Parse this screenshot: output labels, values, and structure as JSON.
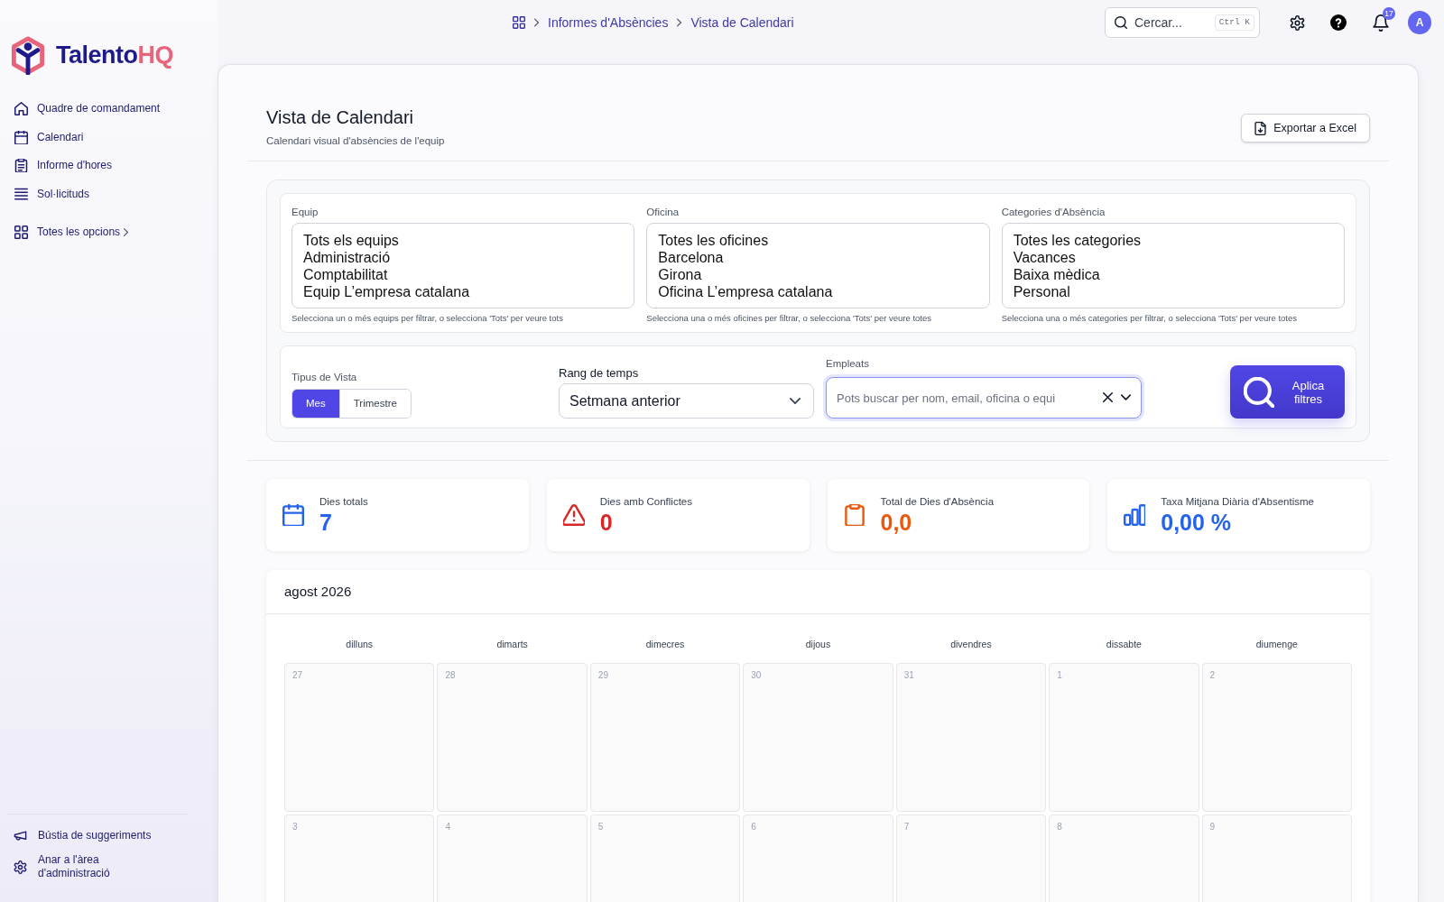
{
  "logo": {
    "name": "Talento",
    "accent": "HQ"
  },
  "sidebar": {
    "items": [
      {
        "kind": "home",
        "label": "Quadre de comandament"
      },
      {
        "kind": "calendar",
        "label": "Calendari"
      },
      {
        "kind": "timesheet",
        "label": "Informe d'hores"
      },
      {
        "kind": "requests",
        "label": "Sol·licituds"
      }
    ],
    "more": {
      "label": "Totes les opcions"
    },
    "footer": [
      {
        "kind": "feedback",
        "label": "Bústia de suggeriments"
      },
      {
        "kind": "admin",
        "label": "Anar a l'àrea d'administració"
      }
    ]
  },
  "breadcrumb": [
    {
      "label": "Informes d'Absències"
    },
    {
      "label": "Vista de Calendari"
    }
  ],
  "top_bar": {
    "search": {
      "placeholder": "Cercar...",
      "shortcut": "Ctrl K"
    },
    "notification_count": "17",
    "avatar": "A"
  },
  "header": {
    "title": "Vista de Calendari",
    "subtitle": "Calendari visual d'absències de l'equip",
    "export_button": "Exportar a Excel"
  },
  "filters": {
    "lists": [
      {
        "label": "Equip",
        "options": [
          "Tots els equips",
          "Administració",
          "Comptabilitat",
          "Equip L’empresa catalana"
        ],
        "help": "Selecciona un o més equips per filtrar, o selecciona 'Tots' per veure tots"
      },
      {
        "label": "Oficina",
        "options": [
          "Totes les oficines",
          "Barcelona",
          "Girona",
          "Oficina L’empresa catalana"
        ],
        "help": "Selecciona una o més oficines per filtrar, o selecciona 'Tots' per veure totes"
      },
      {
        "label": "Categories d'Absència",
        "options": [
          "Totes les categories",
          "Vacances",
          "Baixa mèdica",
          "Personal"
        ],
        "help": "Selecciona una o més categories per filtrar, o selecciona 'Tots' per veure totes"
      }
    ],
    "view_type": {
      "label": "Tipus de Vista",
      "options": [
        {
          "label": "Mes",
          "selected": true
        },
        {
          "label": "Trimestre",
          "selected": false
        }
      ]
    },
    "time_range": {
      "label": "Rang de temps",
      "value": "Setmana anterior"
    },
    "employees": {
      "label": "Empleats",
      "placeholder": "Pots buscar per nom, email, oficina o equi"
    },
    "apply_button": "Aplica filtres"
  },
  "stats": [
    {
      "kind": "total",
      "label": "Dies totals",
      "value": "7",
      "color": "#2563eb"
    },
    {
      "kind": "conflicts",
      "label": "Dies amb Conflictes",
      "value": "0",
      "color": "#dc2626"
    },
    {
      "kind": "absence",
      "label": "Total de Dies d'Absència",
      "value": "0,0",
      "color": "#ea580c"
    },
    {
      "kind": "rate",
      "label": "Taxa Mitjana Diària d'Absentisme",
      "value": "0,00 %",
      "color": "#2563eb"
    }
  ],
  "calendar": {
    "month": "agost 2026",
    "weekdays": [
      "dilluns",
      "dimarts",
      "dimecres",
      "dijous",
      "divendres",
      "dissabte",
      "diumenge"
    ],
    "weeks": [
      [
        "27",
        "28",
        "29",
        "30",
        "31",
        "1",
        "2"
      ],
      [
        "3",
        "4",
        "5",
        "6",
        "7",
        "8",
        "9"
      ]
    ]
  }
}
